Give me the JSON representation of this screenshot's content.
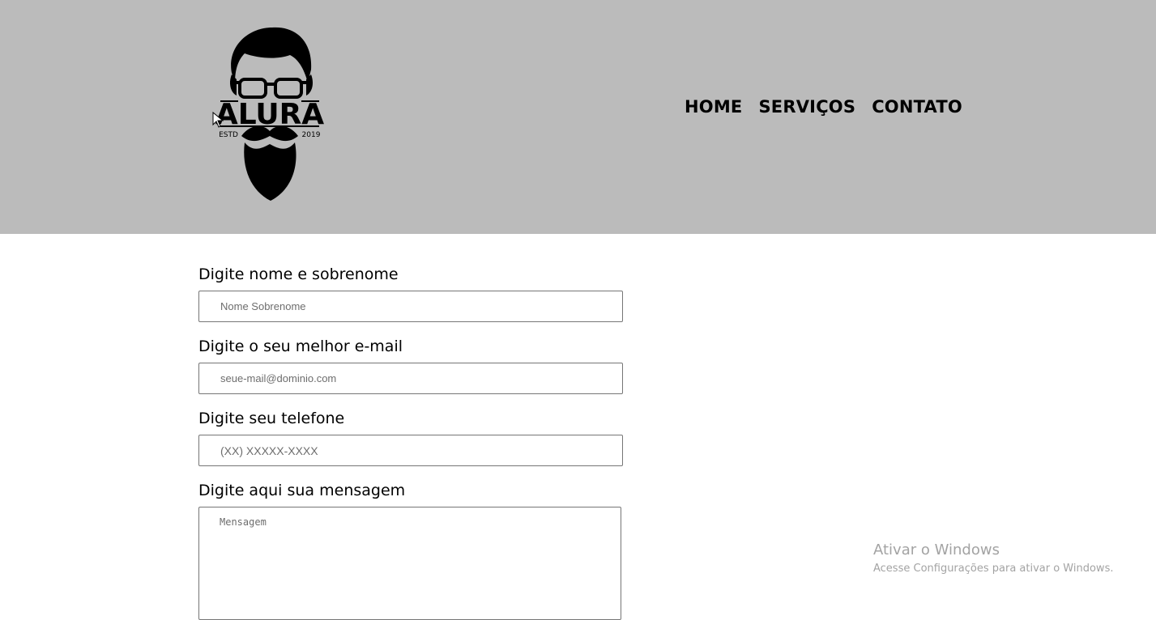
{
  "header": {
    "logo": {
      "brand": "ALURA",
      "left_text": "ESTD",
      "right_text": "2019"
    },
    "nav": [
      {
        "label": "HOME"
      },
      {
        "label": "SERVIÇOS"
      },
      {
        "label": "CONTATO"
      }
    ],
    "background_color": "#bbbbbb"
  },
  "form": {
    "name": {
      "label": "Digite nome e sobrenome",
      "placeholder": "Nome Sobrenome"
    },
    "email": {
      "label": "Digite o seu melhor e-mail",
      "placeholder": "seue-mail@dominio.com"
    },
    "phone": {
      "label": "Digite seu telefone",
      "placeholder": "(XX) XXXXX-XXXX"
    },
    "message": {
      "label": "Digite aqui sua mensagem",
      "placeholder": "Mensagem"
    }
  },
  "watermark": {
    "title": "Ativar o Windows",
    "subtitle": "Acesse Configurações para ativar o Windows."
  }
}
